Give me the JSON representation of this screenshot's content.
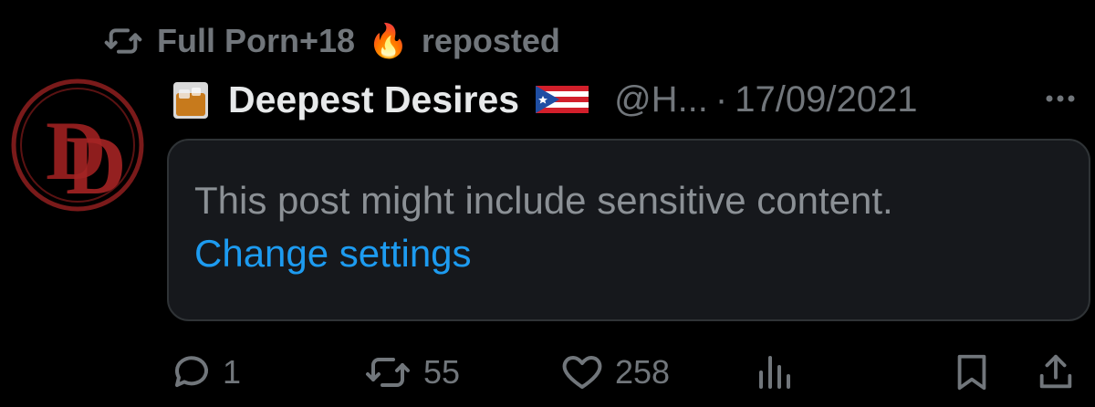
{
  "repost": {
    "icon": "repost-icon",
    "account_name": "Full Porn+18",
    "emoji": "🔥",
    "action_text": "reposted"
  },
  "author": {
    "avatar_icon": "dd-logo-avatar",
    "name_prefix_icon": "whiskey-glass-icon",
    "display_name": "Deepest Desires",
    "flag_icon": "puerto-rico-flag-icon",
    "handle": "@H...",
    "separator": "·",
    "date": "17/09/2021"
  },
  "more_icon": "more-icon",
  "sensitive": {
    "message": "This post might include sensitive content.",
    "link_label": "Change settings"
  },
  "actions": {
    "reply_count": "1",
    "repost_count": "55",
    "like_count": "258"
  },
  "colors": {
    "background": "#000000",
    "text_primary": "#e7e9ea",
    "text_secondary": "#71767b",
    "link": "#1d9bf0",
    "card_bg": "#16181c",
    "card_border": "#2f3336"
  }
}
